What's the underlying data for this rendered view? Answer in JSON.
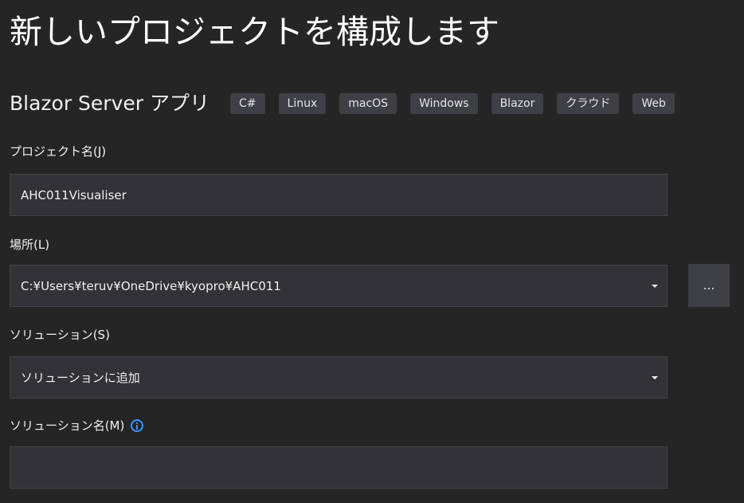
{
  "page": {
    "title": "新しいプロジェクトを構成します"
  },
  "template": {
    "name": "Blazor Server アプリ",
    "tags": [
      "C#",
      "Linux",
      "macOS",
      "Windows",
      "Blazor",
      "クラウド",
      "Web"
    ]
  },
  "project_name": {
    "label": "プロジェクト名(J)",
    "value": "AHC011Visualiser"
  },
  "location": {
    "label": "場所(L)",
    "value": "C:¥Users¥teruv¥OneDrive¥kyopro¥AHC011",
    "browse_label": "..."
  },
  "solution": {
    "label": "ソリューション(S)",
    "value": "ソリューションに追加"
  },
  "solution_name": {
    "label": "ソリューション名(M)",
    "value": "",
    "info_icon": "info-icon"
  },
  "colors": {
    "background": "#252526",
    "field_background": "#333337",
    "tag_background": "#3f3f46",
    "info_accent": "#3794ff"
  }
}
